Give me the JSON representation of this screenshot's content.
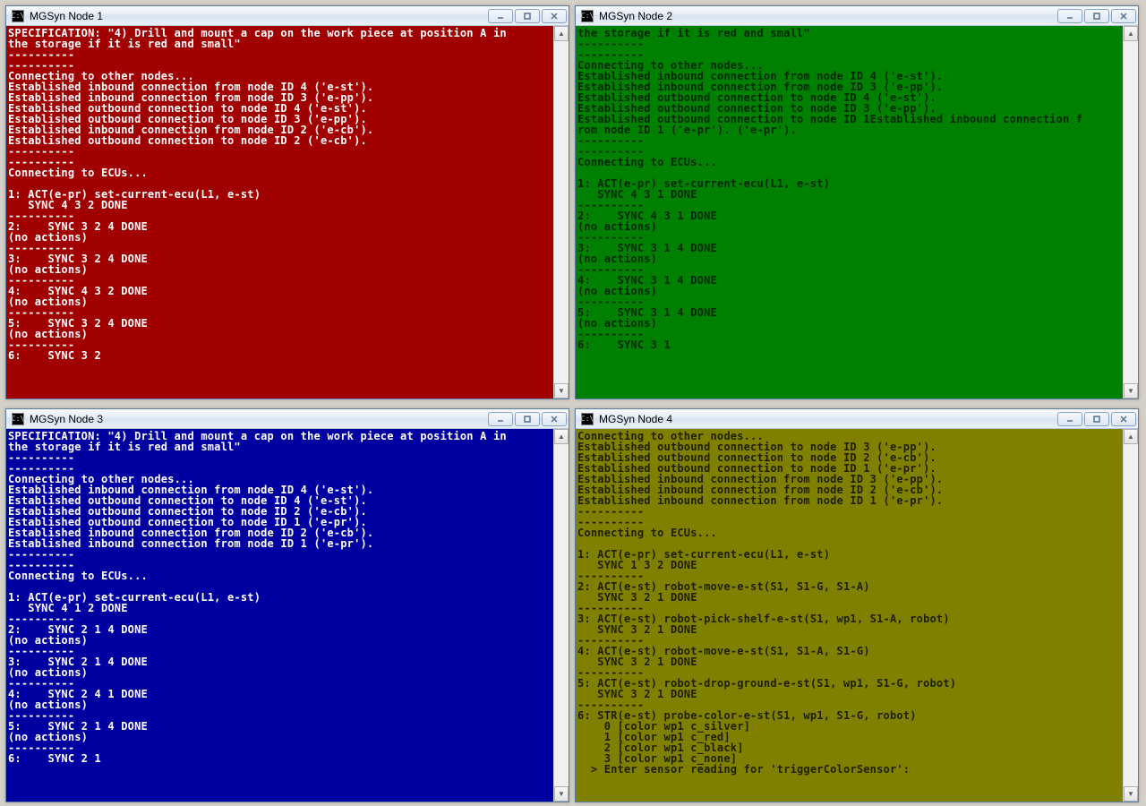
{
  "windows": [
    {
      "id": "win1",
      "title": "MGSyn Node 1",
      "consoleClass": "c-red",
      "lines": [
        "SPECIFICATION: \"4) Drill and mount a cap on the work piece at position A in",
        "the storage if it is red and small\"",
        "----------",
        "----------",
        "Connecting to other nodes...",
        "Established inbound connection from node ID 4 ('e-st').",
        "Established inbound connection from node ID 3 ('e-pp').",
        "Established outbound connection to node ID 4 ('e-st').",
        "Established outbound connection to node ID 3 ('e-pp').",
        "Established inbound connection from node ID 2 ('e-cb').",
        "Established outbound connection to node ID 2 ('e-cb').",
        "----------",
        "----------",
        "Connecting to ECUs...",
        "",
        "1: ACT(e-pr) set-current-ecu(L1, e-st)",
        "   SYNC 4 3 2 DONE",
        "----------",
        "2:    SYNC 3 2 4 DONE",
        "(no actions)",
        "----------",
        "3:    SYNC 3 2 4 DONE",
        "(no actions)",
        "----------",
        "4:    SYNC 4 3 2 DONE",
        "(no actions)",
        "----------",
        "5:    SYNC 3 2 4 DONE",
        "(no actions)",
        "----------",
        "6:    SYNC 3 2"
      ]
    },
    {
      "id": "win2",
      "title": "MGSyn Node 2",
      "consoleClass": "c-green",
      "lines": [
        "the storage if it is red and small\"",
        "----------",
        "----------",
        "Connecting to other nodes...",
        "Established inbound connection from node ID 4 ('e-st').",
        "Established inbound connection from node ID 3 ('e-pp').",
        "Established outbound connection to node ID 4 ('e-st').",
        "Established outbound connection to node ID 3 ('e-pp').",
        "Established outbound connection to node ID 1Established inbound connection f",
        "rom node ID 1 ('e-pr'). ('e-pr').",
        "----------",
        "----------",
        "Connecting to ECUs...",
        "",
        "1: ACT(e-pr) set-current-ecu(L1, e-st)",
        "   SYNC 4 3 1 DONE",
        "----------",
        "2:    SYNC 4 3 1 DONE",
        "(no actions)",
        "----------",
        "3:    SYNC 3 1 4 DONE",
        "(no actions)",
        "----------",
        "4:    SYNC 3 1 4 DONE",
        "(no actions)",
        "----------",
        "5:    SYNC 3 1 4 DONE",
        "(no actions)",
        "----------",
        "6:    SYNC 3 1"
      ]
    },
    {
      "id": "win3",
      "title": "MGSyn Node 3",
      "consoleClass": "c-blue",
      "lines": [
        "SPECIFICATION: \"4) Drill and mount a cap on the work piece at position A in",
        "the storage if it is red and small\"",
        "----------",
        "----------",
        "Connecting to other nodes...",
        "Established inbound connection from node ID 4 ('e-st').",
        "Established outbound connection to node ID 4 ('e-st').",
        "Established outbound connection to node ID 2 ('e-cb').",
        "Established outbound connection to node ID 1 ('e-pr').",
        "Established inbound connection from node ID 2 ('e-cb').",
        "Established inbound connection from node ID 1 ('e-pr').",
        "----------",
        "----------",
        "Connecting to ECUs...",
        "",
        "1: ACT(e-pr) set-current-ecu(L1, e-st)",
        "   SYNC 4 1 2 DONE",
        "----------",
        "2:    SYNC 2 1 4 DONE",
        "(no actions)",
        "----------",
        "3:    SYNC 2 1 4 DONE",
        "(no actions)",
        "----------",
        "4:    SYNC 2 4 1 DONE",
        "(no actions)",
        "----------",
        "5:    SYNC 2 1 4 DONE",
        "(no actions)",
        "----------",
        "6:    SYNC 2 1"
      ]
    },
    {
      "id": "win4",
      "title": "MGSyn Node 4",
      "consoleClass": "c-olive",
      "lines": [
        "Connecting to other nodes...",
        "Established outbound connection to node ID 3 ('e-pp').",
        "Established outbound connection to node ID 2 ('e-cb').",
        "Established outbound connection to node ID 1 ('e-pr').",
        "Established inbound connection from node ID 3 ('e-pp').",
        "Established inbound connection from node ID 2 ('e-cb').",
        "Established inbound connection from node ID 1 ('e-pr').",
        "----------",
        "----------",
        "Connecting to ECUs...",
        "",
        "1: ACT(e-pr) set-current-ecu(L1, e-st)",
        "   SYNC 1 3 2 DONE",
        "----------",
        "2: ACT(e-st) robot-move-e-st(S1, S1-G, S1-A)",
        "   SYNC 3 2 1 DONE",
        "----------",
        "3: ACT(e-st) robot-pick-shelf-e-st(S1, wp1, S1-A, robot)",
        "   SYNC 3 2 1 DONE",
        "----------",
        "4: ACT(e-st) robot-move-e-st(S1, S1-A, S1-G)",
        "   SYNC 3 2 1 DONE",
        "----------",
        "5: ACT(e-st) robot-drop-ground-e-st(S1, wp1, S1-G, robot)",
        "   SYNC 3 2 1 DONE",
        "----------",
        "6: STR(e-st) probe-color-e-st(S1, wp1, S1-G, robot)",
        "    0 [color wp1 c_silver]",
        "    1 [color wp1 c_red]",
        "    2 [color wp1 c_black]",
        "    3 [color wp1 c_none]",
        "  > Enter sensor reading for 'triggerColorSensor':"
      ]
    }
  ],
  "controls": {
    "minimize": "–",
    "maximize": "▢",
    "close": "✕"
  }
}
